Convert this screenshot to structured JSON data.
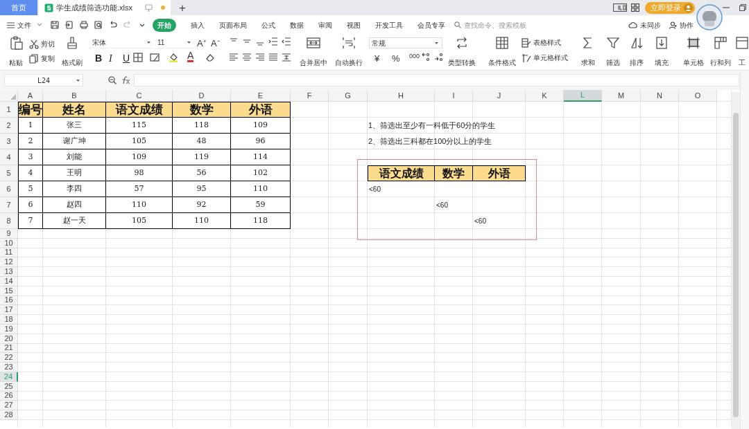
{
  "tabs": [
    {
      "label": "首页",
      "kind": "home",
      "selected": false
    },
    {
      "label": "学生成绩筛选功能.xlsx",
      "kind": "file",
      "selected": true,
      "modified": true
    }
  ],
  "new_tab": "+",
  "login_button": "立即登录",
  "menu": {
    "file": "文件",
    "items": [
      {
        "label": "开始",
        "selected": true
      },
      {
        "label": "插入",
        "selected": false
      },
      {
        "label": "页面布局",
        "selected": false
      },
      {
        "label": "公式",
        "selected": false
      },
      {
        "label": "数据",
        "selected": false
      },
      {
        "label": "审阅",
        "selected": false
      },
      {
        "label": "视图",
        "selected": false
      },
      {
        "label": "开发工具",
        "selected": false
      },
      {
        "label": "会员专享",
        "selected": false
      }
    ],
    "search_placeholder": "查找命令、搜索模板",
    "sync": "未同步",
    "collab": "协作"
  },
  "ribbon": {
    "paste": "粘贴",
    "cut": "剪切",
    "copy": "复制",
    "format_painter": "格式刷",
    "font": "宋体",
    "font_size": "11",
    "font_buttons": [
      "A⁺",
      "A⁻"
    ],
    "style_buttons": [
      "B",
      "I",
      "U"
    ],
    "font_color": "A",
    "merge": "合并居中",
    "wrap": "自动换行",
    "number_format": "常规",
    "number_buttons": [
      "¥",
      "%",
      "000"
    ],
    "convert": "类型转换",
    "conditional": "条件格式",
    "table_style": "表格样式",
    "cell_style": "单元格样式",
    "large_buttons": [
      "求和",
      "筛选",
      "排序",
      "填充",
      "单元格",
      "行和列",
      "工"
    ]
  },
  "name_box": "L24",
  "column_headers": [
    {
      "label": "A",
      "selected": false
    },
    {
      "label": "B",
      "selected": false
    },
    {
      "label": "C",
      "selected": false
    },
    {
      "label": "D",
      "selected": false
    },
    {
      "label": "E",
      "selected": false
    },
    {
      "label": "F",
      "selected": false
    },
    {
      "label": "G",
      "selected": false
    },
    {
      "label": "H",
      "selected": false
    },
    {
      "label": "I",
      "selected": false
    },
    {
      "label": "J",
      "selected": false
    },
    {
      "label": "K",
      "selected": false
    },
    {
      "label": "L",
      "selected": true
    },
    {
      "label": "M",
      "selected": false
    },
    {
      "label": "N",
      "selected": false
    },
    {
      "label": "O",
      "selected": false
    }
  ],
  "row_headers": [
    {
      "label": "1",
      "selected": false
    },
    {
      "label": "2",
      "selected": false
    },
    {
      "label": "3",
      "selected": false
    },
    {
      "label": "4",
      "selected": false
    },
    {
      "label": "5",
      "selected": false
    },
    {
      "label": "6",
      "selected": false
    },
    {
      "label": "7",
      "selected": false
    },
    {
      "label": "8",
      "selected": false
    },
    {
      "label": "9",
      "selected": false
    },
    {
      "label": "10",
      "selected": false
    },
    {
      "label": "11",
      "selected": false
    },
    {
      "label": "12",
      "selected": false
    },
    {
      "label": "13",
      "selected": false
    },
    {
      "label": "14",
      "selected": false
    },
    {
      "label": "15",
      "selected": false
    },
    {
      "label": "16",
      "selected": false
    },
    {
      "label": "17",
      "selected": false
    },
    {
      "label": "18",
      "selected": false
    },
    {
      "label": "19",
      "selected": false
    },
    {
      "label": "20",
      "selected": false
    },
    {
      "label": "21",
      "selected": false
    },
    {
      "label": "22",
      "selected": false
    },
    {
      "label": "23",
      "selected": false
    },
    {
      "label": "24",
      "selected": true
    },
    {
      "label": "25",
      "selected": false
    },
    {
      "label": "26",
      "selected": false
    },
    {
      "label": "27",
      "selected": false
    },
    {
      "label": "28",
      "selected": false
    }
  ],
  "score_table": {
    "columns": [
      "编号",
      "姓名",
      "语文成绩",
      "数学",
      "外语"
    ],
    "rows": [
      [
        "1",
        "张三",
        "115",
        "118",
        "109"
      ],
      [
        "2",
        "谢广坤",
        "105",
        "48",
        "96"
      ],
      [
        "3",
        "刘能",
        "109",
        "119",
        "114"
      ],
      [
        "4",
        "王明",
        "98",
        "56",
        "102"
      ],
      [
        "5",
        "李四",
        "57",
        "95",
        "110"
      ],
      [
        "6",
        "赵四",
        "110",
        "92",
        "59"
      ],
      [
        "7",
        "赵一天",
        "105",
        "110",
        "118"
      ]
    ]
  },
  "notes": [
    "1、筛选出至少有一科低于60分的学生",
    "2、筛选出三科都在100分以上的学生"
  ],
  "criteria_table": {
    "columns": [
      "语文成绩",
      "数学",
      "外语"
    ],
    "rows": [
      [
        "<60",
        null,
        null
      ],
      [
        null,
        "<60",
        null
      ],
      [
        null,
        null,
        "<60"
      ]
    ]
  }
}
